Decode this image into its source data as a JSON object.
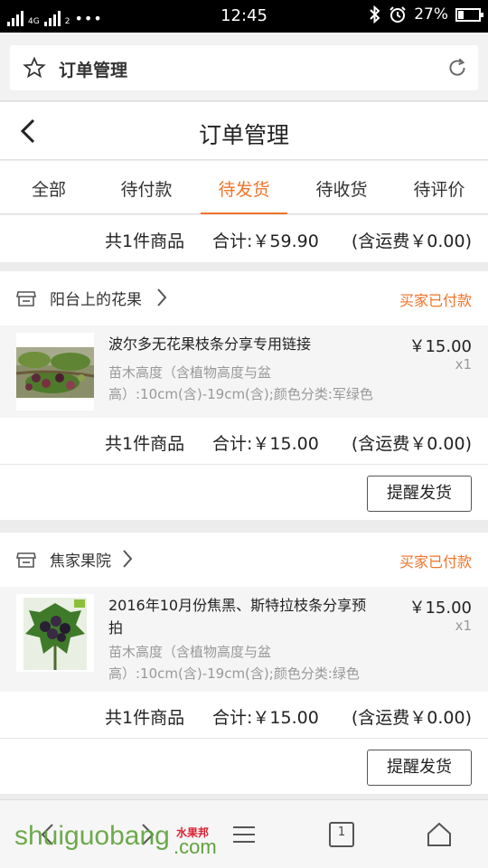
{
  "status_bar": {
    "network": "4G",
    "sim": "2",
    "dots": "•••",
    "time": "12:45",
    "battery": "27%",
    "battery_level": 0.27
  },
  "browser": {
    "page_title": "订单管理",
    "icons": [
      "star-icon",
      "reload-icon"
    ]
  },
  "header": {
    "title": "订单管理"
  },
  "tabs": [
    {
      "label": "全部",
      "active": false
    },
    {
      "label": "待付款",
      "active": false
    },
    {
      "label": "待发货",
      "active": true
    },
    {
      "label": "待收货",
      "active": false
    },
    {
      "label": "待评价",
      "active": false
    }
  ],
  "summary_top": {
    "count": "共1件商品",
    "total": "合计:￥59.90",
    "shipping": "(含运费￥0.00)"
  },
  "orders": [
    {
      "store": "阳台上的花果",
      "status": "买家已付款",
      "product": {
        "name": "波尔多无花果枝条分享专用链接",
        "spec": "苗木高度（含植物高度与盆高）:10cm(含)-19cm(含);颜色分类:军绿色",
        "price": "￥15.00",
        "qty": "x1"
      },
      "summary": {
        "count": "共1件商品",
        "total": "合计:￥15.00",
        "shipping": "(含运费￥0.00)"
      },
      "action": "提醒发货"
    },
    {
      "store": "焦家果院",
      "status": "买家已付款",
      "product": {
        "name": "2016年10月份焦黑、斯特拉枝条分享预拍",
        "spec": "苗木高度（含植物高度与盆高）:10cm(含)-19cm(含);颜色分类:绿色",
        "price": "￥15.00",
        "qty": "x1"
      },
      "summary": {
        "count": "共1件商品",
        "total": "合计:￥15.00",
        "shipping": "(含运费￥0.00)"
      },
      "action": "提醒发货"
    }
  ],
  "toolbar": {
    "tab_count": "1",
    "watermark": "shuiguobang",
    "watermark_cn": "水果邦",
    "watermark_suffix": ".com"
  },
  "colors": {
    "accent": "#f0742a",
    "watermark": "#5fa23a"
  }
}
